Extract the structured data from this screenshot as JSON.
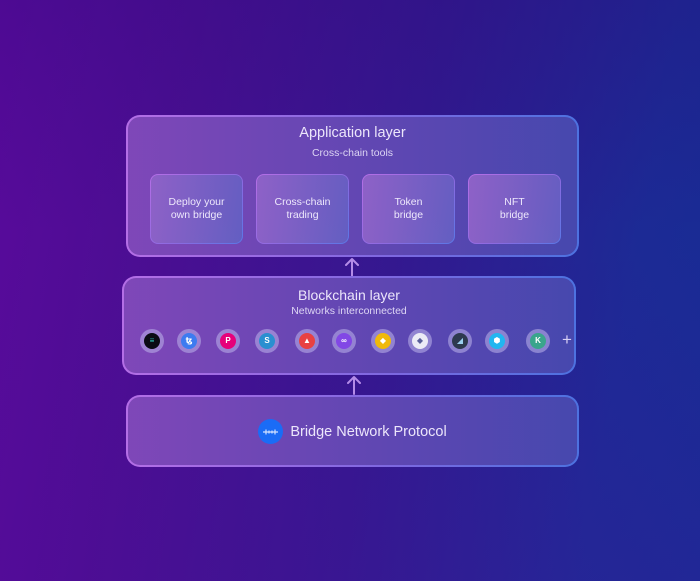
{
  "colors": {
    "background_left": "#5a0a9c",
    "background_right": "#172c94",
    "border_accent_left": "#b46ee6",
    "border_accent_right": "#4d72e0",
    "protocol_logo": "#1a6cf6"
  },
  "application_layer": {
    "title": "Application layer",
    "subtitle": "Cross-chain tools",
    "tools": [
      {
        "label": "Deploy your\nown bridge"
      },
      {
        "label": "Cross-chain\ntrading"
      },
      {
        "label": "Token\nbridge"
      },
      {
        "label": "NFT\nbridge"
      }
    ]
  },
  "blockchain_layer": {
    "title": "Blockchain layer",
    "subtitle": "Networks interconnected",
    "networks": [
      {
        "icon": "solana-icon",
        "glyph": "≡",
        "color": "#0b0b14",
        "glyph_color": "#34d3c6"
      },
      {
        "icon": "tezos-icon",
        "glyph": "ꜩ",
        "color": "#3d7bf0",
        "glyph_color": "#ffffff"
      },
      {
        "icon": "polkadot-icon",
        "glyph": "P",
        "color": "#e6007a",
        "glyph_color": "#ffffff"
      },
      {
        "icon": "stellar-icon",
        "glyph": "S",
        "color": "#2a8fd0",
        "glyph_color": "#ffffff"
      },
      {
        "icon": "avalanche-icon",
        "glyph": "▲",
        "color": "#e84142",
        "glyph_color": "#ffffff"
      },
      {
        "icon": "polygon-icon",
        "glyph": "∞",
        "color": "#8247e5",
        "glyph_color": "#ffffff"
      },
      {
        "icon": "bnb-chain-icon",
        "glyph": "◆",
        "color": "#f0b90b",
        "glyph_color": "#ffffff"
      },
      {
        "icon": "ethereum-icon",
        "glyph": "◆",
        "color": "#ecebf6",
        "glyph_color": "#5a5f9a"
      },
      {
        "icon": "fantom-icon",
        "glyph": "◢",
        "color": "#2e3a4f",
        "glyph_color": "#9ad0f0"
      },
      {
        "icon": "harmony-icon",
        "glyph": "⬢",
        "color": "#21b6f0",
        "glyph_color": "#ffffff"
      },
      {
        "icon": "kucoin-icon",
        "glyph": "K",
        "color": "#3aa58c",
        "glyph_color": "#ffffff"
      }
    ],
    "more_label": "+"
  },
  "protocol_layer": {
    "logo_icon": "bridge-network-logo-icon",
    "name": "Bridge Network Protocol"
  }
}
